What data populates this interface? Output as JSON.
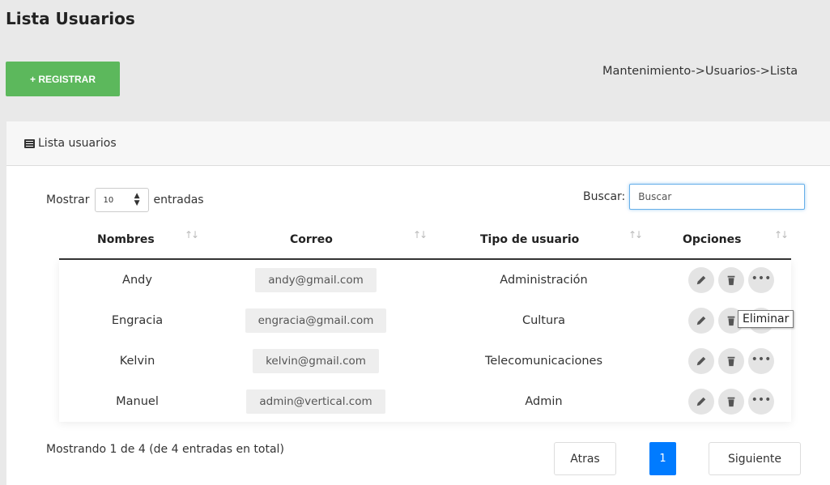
{
  "page": {
    "title": "Lista Usuarios"
  },
  "toolbar": {
    "register_label": "+ REGISTRAR"
  },
  "breadcrumb": "Mantenimiento->Usuarios->Lista",
  "panel": {
    "title": "Lista usuarios",
    "icon": "list-icon"
  },
  "length": {
    "prefix": "Mostrar",
    "value": "10",
    "suffix": "entradas"
  },
  "search": {
    "label": "Buscar:",
    "placeholder": "Buscar",
    "value": ""
  },
  "table": {
    "columns": [
      "Nombres",
      "Correo",
      "Tipo de usuario",
      "Opciones"
    ],
    "rows": [
      {
        "name": "Andy",
        "email": "andy@gmail.com",
        "type": "Administración"
      },
      {
        "name": "Engracia",
        "email": "engracia@gmail.com",
        "type": "Cultura"
      },
      {
        "name": "Kelvin",
        "email": "kelvin@gmail.com",
        "type": "Telecomunicaciones"
      },
      {
        "name": "Manuel",
        "email": "admin@vertical.com",
        "type": "Admin"
      }
    ]
  },
  "tooltip": "Eliminar",
  "info": "Mostrando 1 de 4 (de 4 entradas en total)",
  "pagination": {
    "prev": "Atras",
    "current": "1",
    "next": "Siguiente"
  },
  "colors": {
    "accent_green": "#5cb85c",
    "accent_blue": "#007bff",
    "background": "#e9e9e9"
  }
}
